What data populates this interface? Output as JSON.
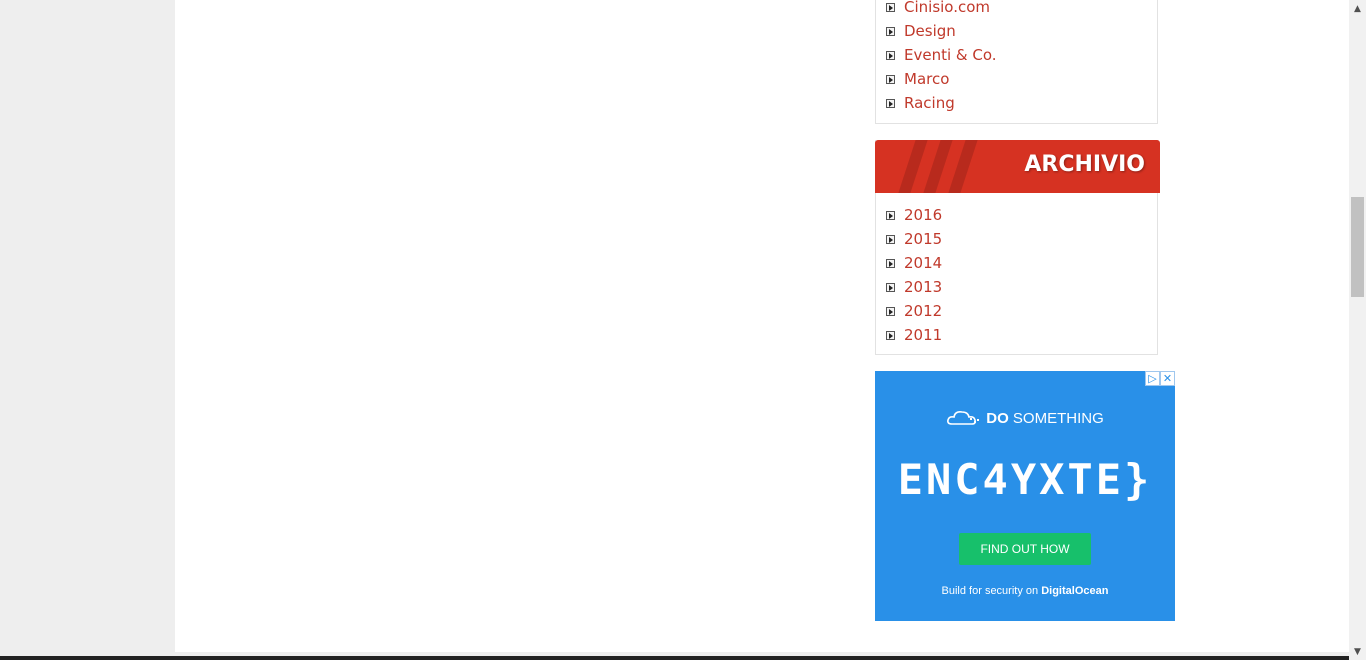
{
  "categories_widget": {
    "items": [
      "Cinisio.com",
      "Design",
      "Eventi & Co.",
      "Marco",
      "Racing"
    ]
  },
  "archive_widget": {
    "title": "ARCHIVIO",
    "items": [
      "2016",
      "2015",
      "2014",
      "2013",
      "2012",
      "2011"
    ]
  },
  "ad": {
    "brand_bold": "DO",
    "brand_rest": "SOMETHING",
    "code": "ENC4YXTE}",
    "button": "FIND OUT HOW",
    "footer_prefix": "Build for security on",
    "footer_brand": "DigitalOcean",
    "icons": [
      "ad-choices-icon",
      "close-icon"
    ]
  },
  "colors": {
    "link": "#c0392b",
    "header_red": "#d63222",
    "ad_blue": "#2990e8",
    "ad_button": "#17c06b",
    "page_bg": "#eeeeee"
  }
}
